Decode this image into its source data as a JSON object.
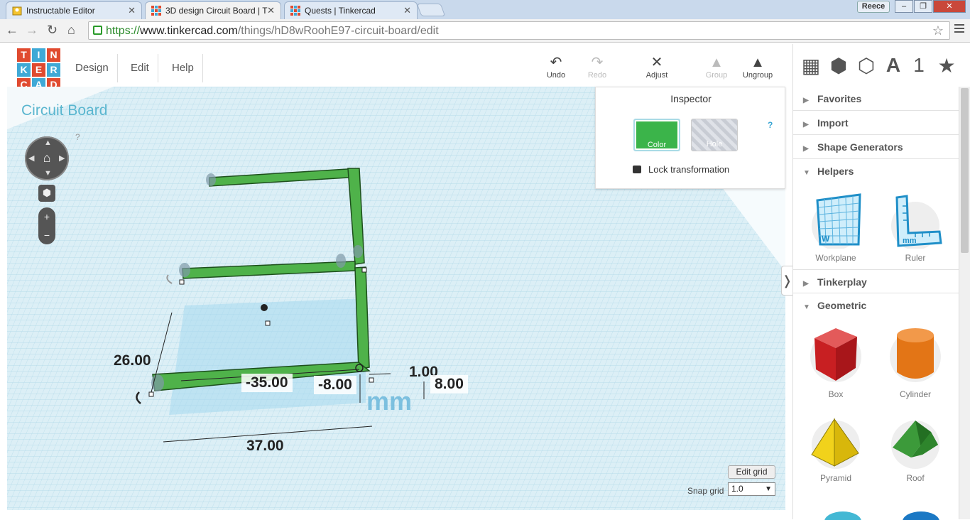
{
  "browser": {
    "tabs": [
      {
        "title": "Instructable Editor",
        "icon": "instructables-icon"
      },
      {
        "title": "3D design Circuit Board | T",
        "icon": "tinkercad-icon"
      },
      {
        "title": "Quests | Tinkercad",
        "icon": "tinkercad-icon"
      }
    ],
    "user": "Reece",
    "url_scheme": "https://",
    "url_host": "www.tinkercad.com",
    "url_path": "/things/hD8wRoohE97-circuit-board/edit"
  },
  "app": {
    "logo": [
      "T",
      "I",
      "N",
      "K",
      "E",
      "R",
      "C",
      "A",
      "D"
    ],
    "menu": [
      "Design",
      "Edit",
      "Help"
    ],
    "tools": [
      {
        "label": "Undo",
        "icon": "undo-icon",
        "enabled": true
      },
      {
        "label": "Redo",
        "icon": "redo-icon",
        "enabled": false
      },
      {
        "label": "Adjust",
        "icon": "adjust-icon",
        "enabled": true
      },
      {
        "label": "Group",
        "icon": "group-icon",
        "enabled": false
      },
      {
        "label": "Ungroup",
        "icon": "ungroup-icon",
        "enabled": true
      }
    ],
    "view_tools": [
      {
        "icon": "grid-view-icon",
        "glyph": "▦"
      },
      {
        "icon": "box-view-icon",
        "glyph": "⬢"
      },
      {
        "icon": "sphere-view-icon",
        "glyph": "⬡"
      },
      {
        "icon": "text-shape-icon",
        "glyph": "A"
      },
      {
        "icon": "number-shape-icon",
        "glyph": "1"
      },
      {
        "icon": "favorites-star-icon",
        "glyph": "★"
      }
    ]
  },
  "workplane": {
    "design_title": "Circuit Board",
    "help": "?",
    "unit": "mm",
    "dims": {
      "height": "26.00",
      "x_offset": "-35.00",
      "y_offset": "-8.00",
      "thickness": "1.00",
      "depth": "8.00",
      "length": "37.00"
    },
    "edit_grid_label": "Edit grid",
    "snap_label": "Snap grid",
    "snap_value": "1.0"
  },
  "inspector": {
    "title": "Inspector",
    "color_label": "Color",
    "hole_label": "Hole",
    "help": "?",
    "lock_label": "Lock transformation",
    "accent": "#3bb44a"
  },
  "sidebar": {
    "sections": [
      {
        "label": "Favorites",
        "open": false
      },
      {
        "label": "Import",
        "open": false
      },
      {
        "label": "Shape Generators",
        "open": false
      },
      {
        "label": "Helpers",
        "open": true
      },
      {
        "label": "Tinkerplay",
        "open": false
      },
      {
        "label": "Geometric",
        "open": true
      }
    ],
    "helpers": [
      "Workplane",
      "Ruler"
    ],
    "geometric": [
      "Box",
      "Cylinder",
      "Pyramid",
      "Roof"
    ]
  }
}
